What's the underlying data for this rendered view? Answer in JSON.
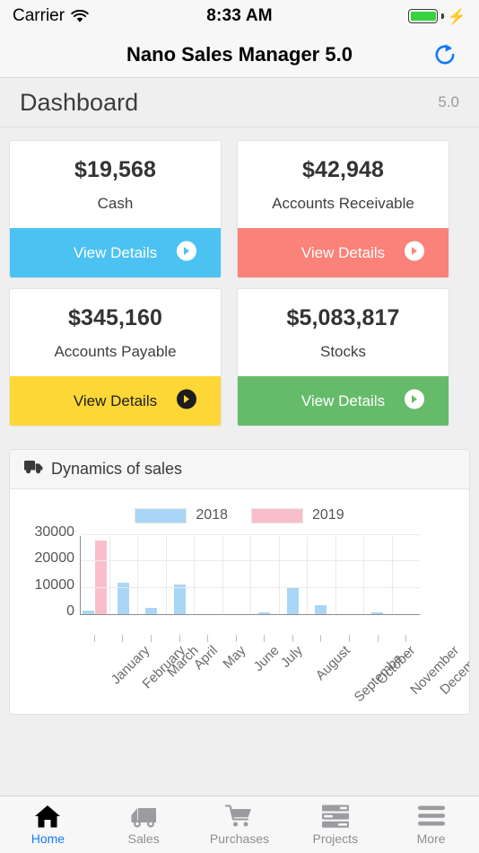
{
  "statusbar": {
    "carrier": "Carrier",
    "time": "8:33 AM",
    "wifi_icon": "wifi-icon",
    "battery_icon": "battery-icon",
    "charging_icon": "⚡",
    "battery_color": "#36D33F"
  },
  "navbar": {
    "title": "Nano Sales Manager 5.0",
    "refresh_icon": "refresh-icon",
    "refresh_color": "#1379FB"
  },
  "pageheader": {
    "title": "Dashboard",
    "version": "5.0"
  },
  "cards": [
    {
      "value": "$19,568",
      "label": "Cash",
      "button_label": "View Details",
      "color": "#4CC2F2",
      "text_style": "light",
      "arrow_icon": "arrow-right-circle-icon"
    },
    {
      "value": "$42,948",
      "label": "Accounts Receivable",
      "button_label": "View Details",
      "color": "#FB8279",
      "text_style": "light",
      "arrow_icon": "arrow-right-circle-icon"
    },
    {
      "value": "$345,160",
      "label": "Accounts Payable",
      "button_label": "View Details",
      "color": "#FCD736",
      "text_style": "dark",
      "arrow_icon": "arrow-right-circle-icon"
    },
    {
      "value": "$5,083,817",
      "label": "Stocks",
      "button_label": "View Details",
      "color": "#66BB6A",
      "text_style": "light",
      "arrow_icon": "arrow-right-circle-icon"
    }
  ],
  "panel": {
    "title": "Dynamics of sales",
    "icon": "truck-icon"
  },
  "chart_data": {
    "type": "bar",
    "title": "Dynamics of sales",
    "xlabel": "",
    "ylabel": "",
    "ylim": [
      0,
      30000
    ],
    "yticks": [
      0,
      10000,
      20000,
      30000
    ],
    "ytick_labels": [
      "0",
      "10000",
      "20000",
      "30000"
    ],
    "grid": true,
    "legend_position": "top-center",
    "categories": [
      "January",
      "February",
      "March",
      "April",
      "May",
      "June",
      "July",
      "August",
      "Septembe...",
      "October",
      "November",
      "December"
    ],
    "series": [
      {
        "name": "2018",
        "color": "#A9D6F6",
        "values": [
          1400,
          12000,
          2500,
          11200,
          0,
          0,
          700,
          10000,
          3500,
          0,
          400,
          0
        ]
      },
      {
        "name": "2019",
        "color": "#F9BECB",
        "values": [
          28000,
          0,
          0,
          0,
          0,
          0,
          0,
          0,
          0,
          0,
          0,
          0
        ]
      }
    ]
  },
  "tabbar": {
    "items": [
      {
        "label": "Home",
        "icon": "home-icon",
        "active": true
      },
      {
        "label": "Sales",
        "icon": "truck-icon",
        "active": false
      },
      {
        "label": "Purchases",
        "icon": "shopping-cart-icon",
        "active": false
      },
      {
        "label": "Projects",
        "icon": "server-list-icon",
        "active": false
      },
      {
        "label": "More",
        "icon": "hamburger-menu-icon",
        "active": false
      }
    ],
    "active_color": "#1379FB",
    "inactive_color": "#8E8E93"
  }
}
